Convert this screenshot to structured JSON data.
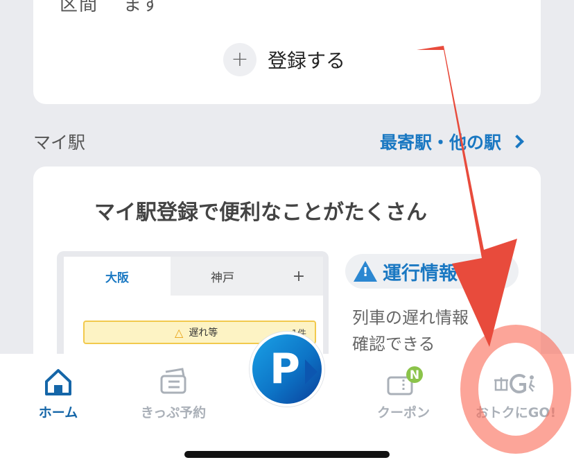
{
  "top_card": {
    "cut_text_left": "区間",
    "cut_text_right": "ます",
    "register_icon": "plus-icon",
    "register_label": "登録する"
  },
  "my_station": {
    "section_title": "マイ駅",
    "nearby_link": "最寄駅・他の駅"
  },
  "promo_card": {
    "heading": "マイ駅登録で便利なことがたくさん",
    "mock": {
      "tabs": [
        "大阪",
        "神戸",
        "+"
      ],
      "delay_label": "遅れ等",
      "delay_count": "1件"
    },
    "info_title": "運行情報",
    "info_desc": [
      "列車の遅れ情報",
      "確認できる"
    ]
  },
  "bottom_nav": {
    "items": [
      {
        "label": "ホーム",
        "icon": "home-icon",
        "active": true
      },
      {
        "label": "きっぷ予約",
        "icon": "ticket-icon",
        "active": false
      },
      {
        "label": "クーポン",
        "icon": "coupon-icon",
        "badge": "N",
        "active": false
      },
      {
        "label": "おトクにGO!",
        "icon": "gift-go-icon",
        "active": false
      }
    ],
    "center_button_letter": "P"
  },
  "colors": {
    "accent_blue": "#1a78c2",
    "active_nav": "#1566a8",
    "inactive_nav": "#aab0b8",
    "annotation_red": "#e84b3c",
    "badge_green": "#8bc34a"
  }
}
